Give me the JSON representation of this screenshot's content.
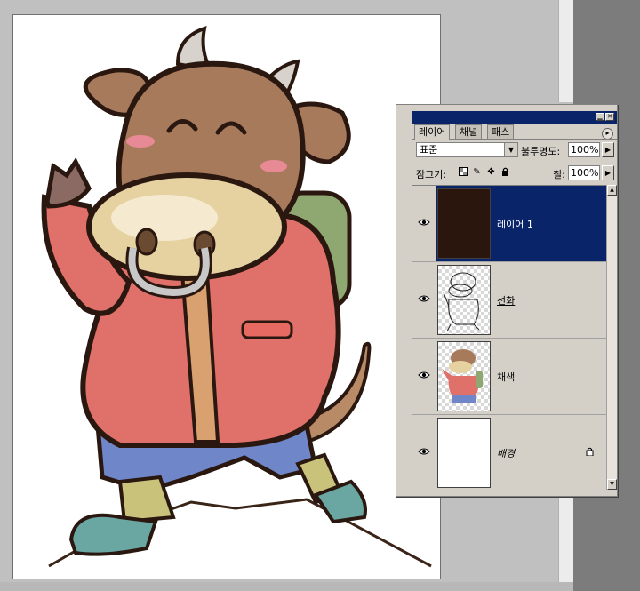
{
  "layers_panel": {
    "tabs": [
      "레이어",
      "채널",
      "패스"
    ],
    "active_tab": "레이어",
    "blend_mode": "표준",
    "opacity_label": "불투명도:",
    "opacity_value": "100%",
    "lock_label": "잠그기:",
    "fill_label": "칠:",
    "fill_value": "100%",
    "layers": [
      {
        "name": "레이어 1",
        "selected": true,
        "thumbnail": "dark-fill"
      },
      {
        "name": "선화",
        "selected": false,
        "thumbnail": "lineart"
      },
      {
        "name": "채색",
        "selected": false,
        "thumbnail": "color"
      },
      {
        "name": "배경",
        "selected": false,
        "thumbnail": "white",
        "locked": true
      }
    ]
  },
  "colors": {
    "title_bar": "#0a246a",
    "selection": "#0a246a",
    "panel_bg": "#d4d0c8",
    "workspace": "#c0c0c0"
  },
  "icons": {
    "visibility": "eye-icon",
    "lock_transparency": "checker-square-icon",
    "lock_paint": "brush-icon",
    "lock_move": "move-arrows-icon",
    "lock_all": "padlock-icon"
  }
}
